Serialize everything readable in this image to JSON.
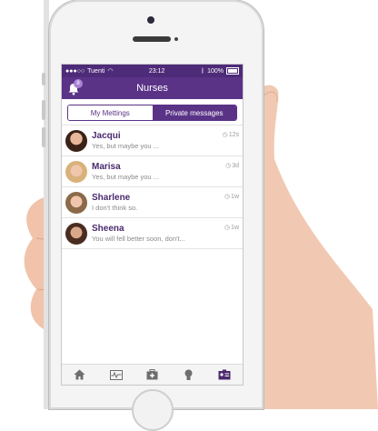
{
  "status_bar": {
    "carrier": "Tuenti",
    "time": "23:12",
    "battery": "100%"
  },
  "nav": {
    "title": "Nurses",
    "badge_count": "8"
  },
  "segments": [
    {
      "label": "My Mettings",
      "active": false
    },
    {
      "label": "Private messages",
      "active": true
    }
  ],
  "messages": [
    {
      "name": "Jacqui",
      "preview": "Yes, but maybe you ...",
      "time": "12s"
    },
    {
      "name": "Marisa",
      "preview": "Yes, but maybe you ...",
      "time": "3d"
    },
    {
      "name": "Sharlene",
      "preview": "I don't think so.",
      "time": "1w"
    },
    {
      "name": "Sheena",
      "preview": "You will fell better soon, don't...",
      "time": "1w"
    }
  ],
  "tabbar": [
    {
      "icon": "home-icon"
    },
    {
      "icon": "heart-monitor-icon"
    },
    {
      "icon": "medical-kit-icon"
    },
    {
      "icon": "lightbulb-icon"
    },
    {
      "icon": "id-card-icon"
    }
  ],
  "colors": {
    "brand": "#5a3387",
    "statusbar": "#4e2b78"
  }
}
